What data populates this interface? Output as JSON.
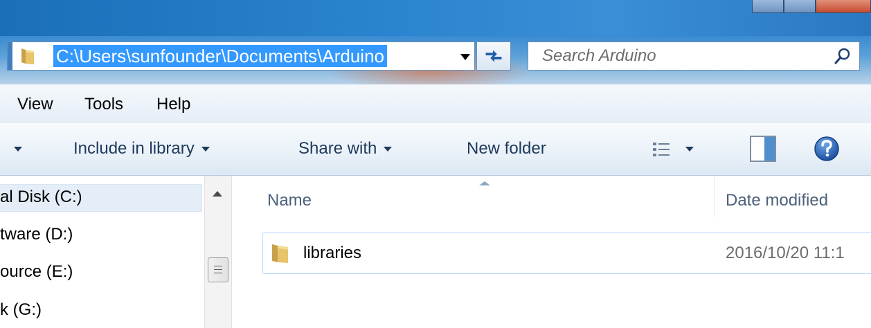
{
  "address_bar": {
    "path": "C:\\Users\\sunfounder\\Documents\\Arduino",
    "folder_icon": "folder-icon",
    "dropdown_icon": "chevron-down-icon",
    "refresh_icon": "refresh-icon"
  },
  "search": {
    "placeholder": "Search Arduino",
    "icon": "search-icon"
  },
  "menu": {
    "items": [
      "View",
      "Tools",
      "Help"
    ]
  },
  "toolbar": {
    "include_in_library": "Include in library",
    "share_with": "Share with",
    "new_folder": "New folder",
    "view_icon": "view-details-icon",
    "preview_icon": "preview-pane-icon",
    "help_icon": "help-icon"
  },
  "nav_pane": {
    "items": [
      "al Disk (C:)",
      "tware (D:)",
      "ource (E:)",
      "k (G:)"
    ],
    "selected_index": 0
  },
  "content": {
    "columns": {
      "name": "Name",
      "date_modified": "Date modified"
    },
    "rows": [
      {
        "name": "libraries",
        "date": "2016/10/20 11:1",
        "icon": "folder-icon"
      }
    ]
  },
  "colors": {
    "accent": "#3399ff",
    "window_frame": "#2b84cf",
    "toolbar_text": "#1e395b"
  }
}
